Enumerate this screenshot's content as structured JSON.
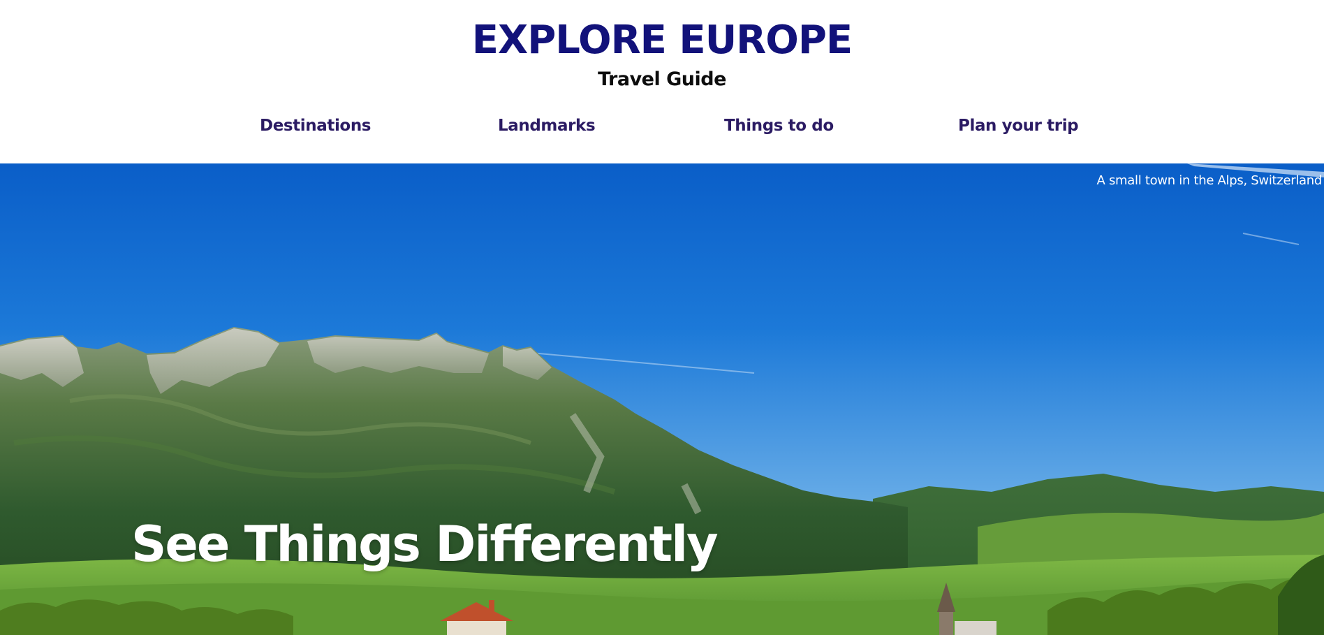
{
  "header": {
    "title": "EXPLORE EUROPE",
    "subtitle": "Travel Guide"
  },
  "nav": {
    "items": [
      {
        "label": "Destinations"
      },
      {
        "label": "Landmarks"
      },
      {
        "label": "Things to do"
      },
      {
        "label": "Plan your trip"
      }
    ]
  },
  "hero": {
    "caption": "A small town in the Alps, Switzerland",
    "headline": "See Things Differently",
    "image": "alpine-mountain-village-landscape"
  },
  "colors": {
    "title": "#12127a",
    "nav": "#2b1b63",
    "sky_top": "#0a5ec8",
    "sky_bottom": "#8fc2ee"
  }
}
